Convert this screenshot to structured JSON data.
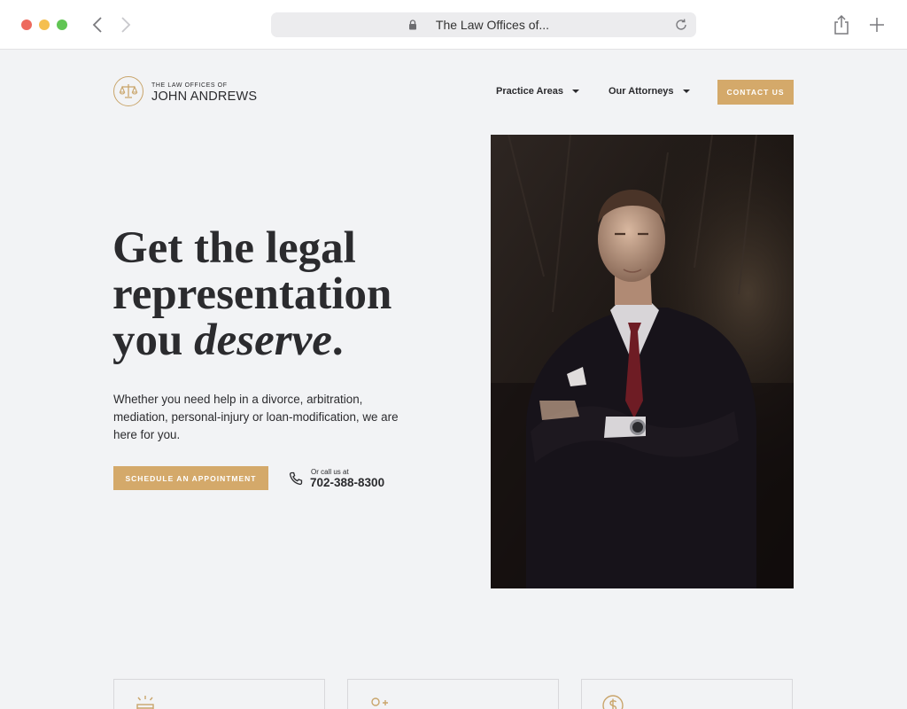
{
  "browser": {
    "url_title": "The Law Offices of..."
  },
  "logo": {
    "small": "THE LAW OFFICES OF",
    "big": "JOHN ANDREWS"
  },
  "nav": {
    "items": [
      {
        "label": "Practice Areas"
      },
      {
        "label": "Our Attorneys"
      }
    ],
    "contact_label": "CONTACT US"
  },
  "hero": {
    "headline_line1": "Get the legal",
    "headline_line2": "representation",
    "headline_you": "you ",
    "headline_emph": "deserve",
    "headline_end": ".",
    "subtext": "Whether you need help in a divorce, arbitration, mediation, personal-injury or loan-modification, we are here for you.",
    "cta_label": "SCHEDULE AN APPOINTMENT",
    "call_label": "Or call us at",
    "phone": "702-388-8300"
  },
  "colors": {
    "accent": "#d4a96a",
    "text": "#2b2b2e",
    "background": "#f2f3f5"
  },
  "icons": [
    "lock-icon",
    "reload-icon",
    "share-icon",
    "plus-icon",
    "scales-icon",
    "phone-icon",
    "gavel-icon",
    "person-icon",
    "dollar-icon"
  ]
}
